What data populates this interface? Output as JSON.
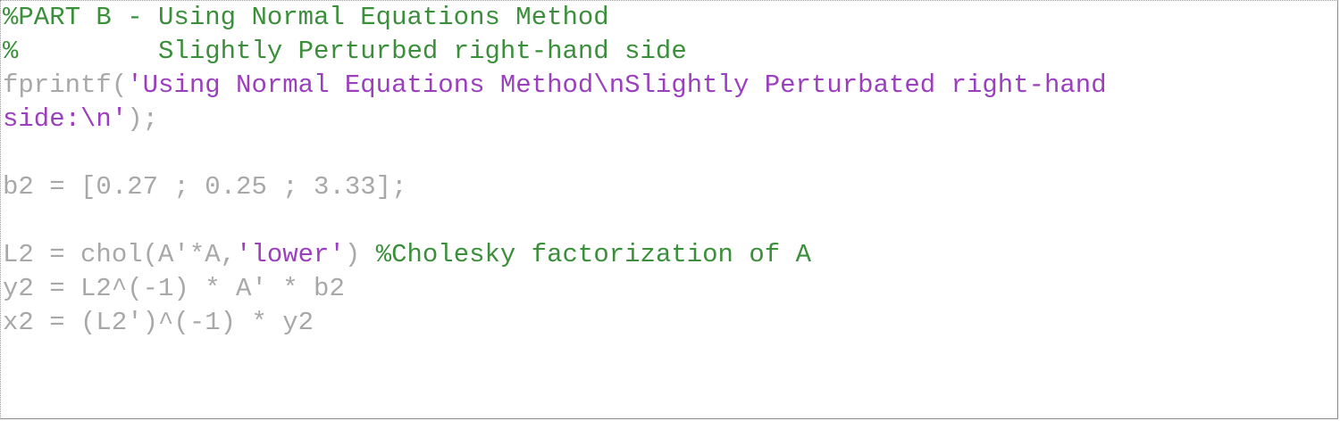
{
  "editor": {
    "colors": {
      "comment": "#3b8f3b",
      "string": "#9b3fbf",
      "code": "#a8a8a8",
      "background": "#ffffff"
    },
    "lines": [
      {
        "segments": [
          {
            "type": "comment",
            "text": "%PART B - Using Normal Equations Method"
          }
        ]
      },
      {
        "segments": [
          {
            "type": "comment",
            "text": "%         Slightly Perturbed right-hand side"
          }
        ]
      },
      {
        "segments": [
          {
            "type": "plain",
            "text": "fprintf("
          },
          {
            "type": "string",
            "text": "'Using Normal Equations Method\\nSlightly Perturbated right-hand"
          }
        ]
      },
      {
        "segments": [
          {
            "type": "string",
            "text": "side:\\n'"
          },
          {
            "type": "plain",
            "text": ");"
          }
        ]
      },
      {
        "segments": []
      },
      {
        "segments": [
          {
            "type": "plain",
            "text": "b2 = [0.27 ; 0.25 ; 3.33];"
          }
        ]
      },
      {
        "segments": []
      },
      {
        "segments": [
          {
            "type": "plain",
            "text": "L2 = chol(A'*A,"
          },
          {
            "type": "string",
            "text": "'lower'"
          },
          {
            "type": "plain",
            "text": ") "
          },
          {
            "type": "comment",
            "text": "%Cholesky factorization of A"
          }
        ]
      },
      {
        "segments": [
          {
            "type": "plain",
            "text": "y2 = L2^(-1) * A' * b2"
          }
        ]
      },
      {
        "segments": [
          {
            "type": "plain",
            "text": "x2 = (L2')^(-1) * y2"
          }
        ]
      }
    ]
  }
}
